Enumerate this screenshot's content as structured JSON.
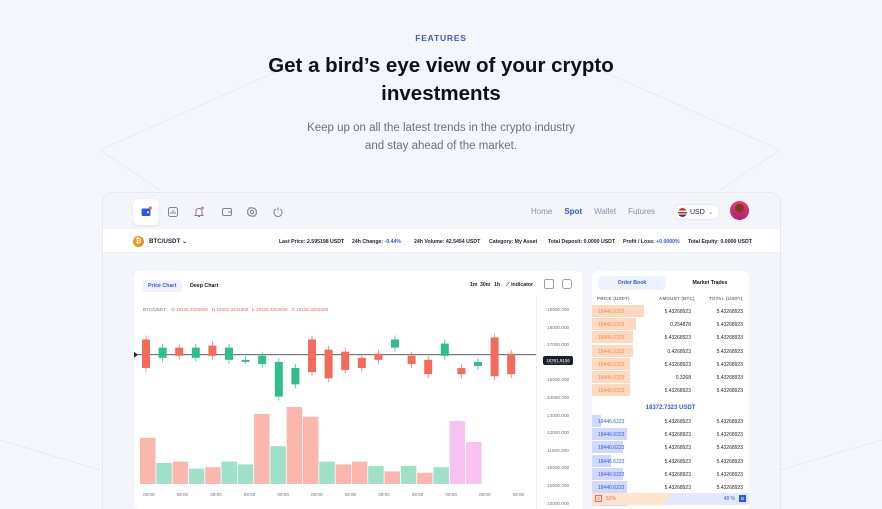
{
  "colors": {
    "accent": "#2f57e8",
    "buy": "#2fbf8f",
    "sell": "#f26b5b",
    "pink": "#f7a8e0",
    "dark": "#1b1e2a"
  },
  "hero": {
    "eyebrow": "FEATURES",
    "title_line1": "Get a bird’s eye view of your crypto",
    "title_line2": "investments",
    "subtitle_line1": "Keep up on all the latest trends in the crypto industry",
    "subtitle_line2": "and stay ahead of the market."
  },
  "sidebar_icons": [
    "wallet-icon",
    "chart-icon",
    "bell-icon",
    "card-icon",
    "gear-icon",
    "power-icon"
  ],
  "nav": {
    "home": "Home",
    "spot": "Spot",
    "wallet": "Wallet",
    "futures": "Futures",
    "currency": "USD"
  },
  "ticker": {
    "pair": "BTC/USDT",
    "last_price_label": "Last Price:",
    "last_price": "2.595198 USDT",
    "change_label": "24h Change:",
    "change": "-0.44%",
    "volume_label": "24h Volume:",
    "volume": "42.5454 USDT",
    "category_label": "Category:",
    "category": "My Asset",
    "deposit_label": "Total Deposit:",
    "deposit": "0.0000 USDT",
    "pl_label": "Profit / Loss:",
    "pl": "+0.0000%",
    "equity_label": "Total Equity:",
    "equity": "0.0000 USDT"
  },
  "chart_panel": {
    "tab_price": "Price Chart",
    "tab_deep": "Deep Chart",
    "tf_1m": "1m",
    "tf_30m": "30m",
    "tf_1h": "1h",
    "indicator": "Indicator",
    "ohlc_pair": "BTC/USDT",
    "o_label": "O",
    "o": "18432.3204608",
    "h_label": "H",
    "h": "18432.3204608",
    "l_label": "L",
    "l": "18432.3204608",
    "c_label": "C",
    "c": "18432.3204608",
    "price_tag": "18391.9156"
  },
  "chart_data": {
    "type": "candlestick",
    "y_ticks": [
      "19000.000",
      "18000.000",
      "17000.000",
      "16000.000",
      "15000.000",
      "14000.000",
      "13000.000",
      "12000.000",
      "11000.000",
      "10000.000",
      "10000.000",
      "10000.000"
    ],
    "x_ticks": [
      "09:00",
      "09:00",
      "09:00",
      "09:00",
      "09:00",
      "09:00",
      "09:00",
      "09:00",
      "09:00",
      "09:00",
      "09:00",
      "09:00"
    ],
    "ylim": [
      5,
      0
    ],
    "candles": [
      {
        "o": 2.6,
        "c": 1.2,
        "up": false
      },
      {
        "o": 2.1,
        "c": 1.6,
        "up": true
      },
      {
        "o": 1.6,
        "c": 2.0,
        "up": false
      },
      {
        "o": 2.1,
        "c": 1.6,
        "up": true
      },
      {
        "o": 1.5,
        "c": 2.0,
        "up": false
      },
      {
        "o": 1.6,
        "c": 2.2,
        "up": true
      },
      {
        "o": 2.2,
        "c": 2.2,
        "up": true
      },
      {
        "o": 2.0,
        "c": 2.4,
        "up": true
      },
      {
        "o": 2.3,
        "c": 4.0,
        "up": true
      },
      {
        "o": 3.4,
        "c": 2.6,
        "up": true
      },
      {
        "o": 1.2,
        "c": 2.8,
        "up": false
      },
      {
        "o": 1.7,
        "c": 3.1,
        "up": false
      },
      {
        "o": 1.8,
        "c": 2.7,
        "up": false
      },
      {
        "o": 2.1,
        "c": 2.6,
        "up": false
      },
      {
        "o": 1.9,
        "c": 2.2,
        "up": false
      },
      {
        "o": 1.2,
        "c": 1.6,
        "up": true
      },
      {
        "o": 2.0,
        "c": 2.4,
        "up": false
      },
      {
        "o": 2.2,
        "c": 2.9,
        "up": false
      },
      {
        "o": 2.0,
        "c": 1.4,
        "up": true
      },
      {
        "o": 2.6,
        "c": 2.9,
        "up": false
      },
      {
        "o": 2.3,
        "c": 2.5,
        "up": true
      },
      {
        "o": 1.1,
        "c": 3.0,
        "up": false
      },
      {
        "o": 1.9,
        "c": 2.9,
        "up": false
      }
    ],
    "volumes": [
      {
        "v": 3.3,
        "c": "s"
      },
      {
        "v": 1.5,
        "c": "b"
      },
      {
        "v": 1.6,
        "c": "s"
      },
      {
        "v": 1.1,
        "c": "b"
      },
      {
        "v": 1.2,
        "c": "s"
      },
      {
        "v": 1.6,
        "c": "b"
      },
      {
        "v": 1.4,
        "c": "b"
      },
      {
        "v": 5.0,
        "c": "s"
      },
      {
        "v": 2.7,
        "c": "b"
      },
      {
        "v": 5.5,
        "c": "s"
      },
      {
        "v": 4.8,
        "c": "s"
      },
      {
        "v": 1.6,
        "c": "b"
      },
      {
        "v": 1.4,
        "c": "s"
      },
      {
        "v": 1.6,
        "c": "s"
      },
      {
        "v": 1.3,
        "c": "b"
      },
      {
        "v": 0.9,
        "c": "s"
      },
      {
        "v": 1.3,
        "c": "b"
      },
      {
        "v": 0.8,
        "c": "s"
      },
      {
        "v": 1.2,
        "c": "b"
      },
      {
        "v": 4.5,
        "c": "p"
      },
      {
        "v": 3.0,
        "c": "p"
      }
    ]
  },
  "order_book": {
    "tab_book": "Order Book",
    "tab_trades": "Market Trades",
    "col_price": "PRICE (USDT)",
    "col_amount": "AMOUNT (BTC)",
    "col_total": "TOTAL (USDT)",
    "asks": [
      {
        "price": "18446.6223",
        "amount": "5.43268923",
        "total": "5.43268923",
        "depth": 0.33
      },
      {
        "price": "18446.6223",
        "amount": "0.254878",
        "total": "5.43268923",
        "depth": 0.28
      },
      {
        "price": "18446.6223",
        "amount": "5.43268923",
        "total": "5.43268923",
        "depth": 0.26
      },
      {
        "price": "18446.6223",
        "amount": "0.4268923",
        "total": "5.43268923",
        "depth": 0.26
      },
      {
        "price": "18446.6223",
        "amount": "5.43268923",
        "total": "5.43268923",
        "depth": 0.24
      },
      {
        "price": "18446.6223",
        "amount": "0.3268",
        "total": "5.43268923",
        "depth": 0.24
      },
      {
        "price": "18446.6223",
        "amount": "5.43268923",
        "total": "5.43268923",
        "depth": 0.24
      }
    ],
    "mid_price": "18372.7323 USDT",
    "bids": [
      {
        "price": "18446.6223",
        "amount": "5.43268923",
        "total": "5.43268923",
        "depth": 0.06
      },
      {
        "price": "18446.6223",
        "amount": "5.43268923",
        "total": "5.43268923",
        "depth": 0.22
      },
      {
        "price": "18446.6223",
        "amount": "5.43268923",
        "total": "5.43268923",
        "depth": 0.2
      },
      {
        "price": "18446.6223",
        "amount": "5.43268923",
        "total": "5.43268923",
        "depth": 0.12
      },
      {
        "price": "18446.6223",
        "amount": "5.43268923",
        "total": "5.43268923",
        "depth": 0.2
      },
      {
        "price": "18446.6223",
        "amount": "5.43268923",
        "total": "5.43268923",
        "depth": 0.22
      },
      {
        "price": "18446.6223",
        "amount": "5.43268923",
        "total": "5.43268923",
        "depth": 0.22
      }
    ],
    "sell_pct_label": "S",
    "sell_pct": "52%",
    "buy_pct": "48 %",
    "buy_pct_label": "B"
  }
}
